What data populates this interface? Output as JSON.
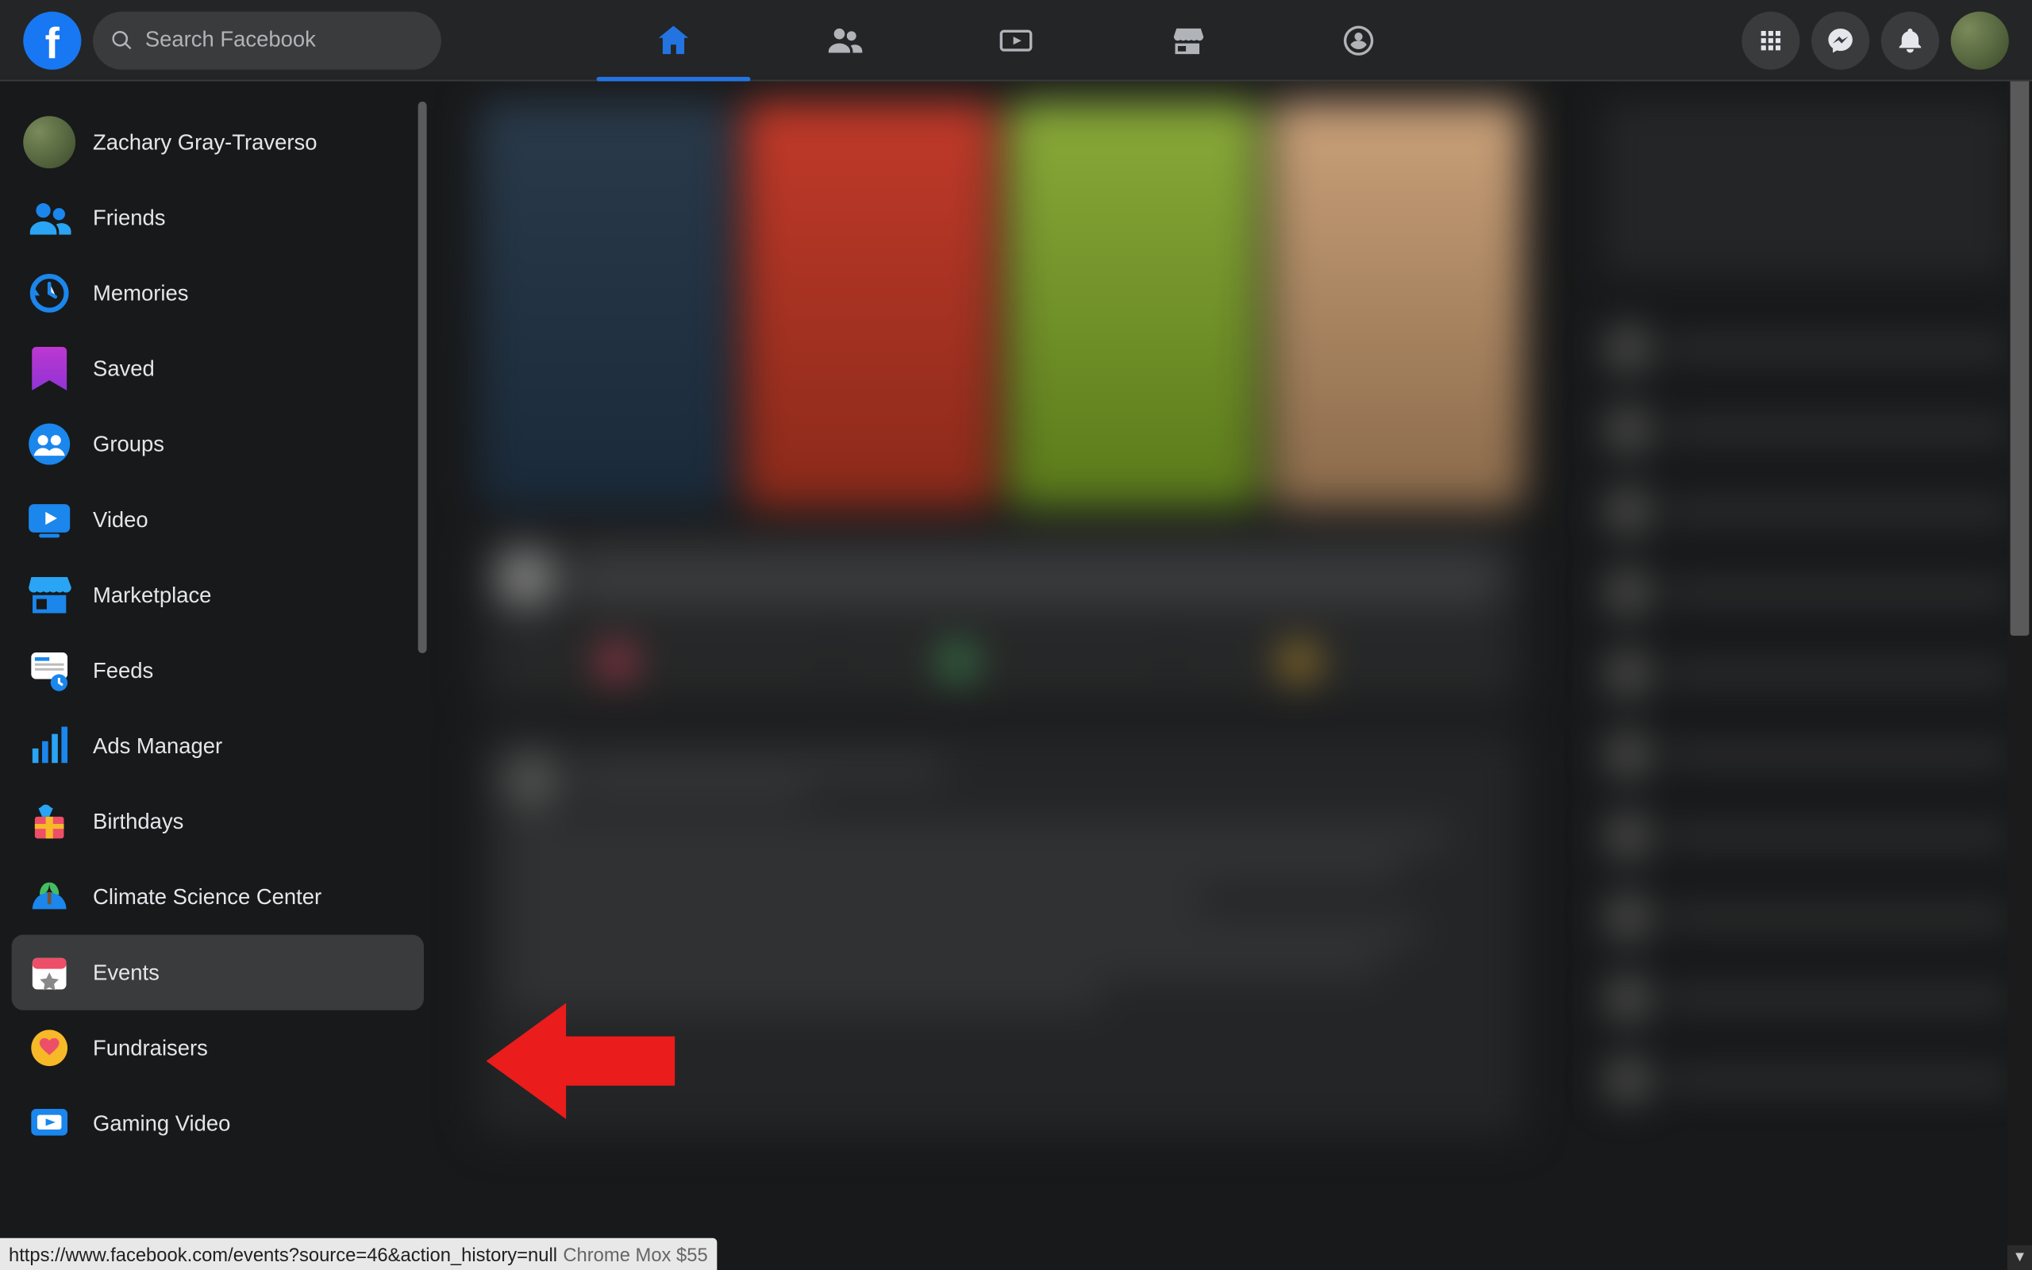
{
  "search": {
    "placeholder": "Search Facebook"
  },
  "user": {
    "name": "Zachary Gray-Traverso"
  },
  "header_tabs": {
    "home": "Home",
    "friends": "Friends",
    "video": "Video",
    "marketplace": "Marketplace",
    "groups": "Groups"
  },
  "header_right": {
    "menu": "Menu",
    "messenger": "Messenger",
    "notifications": "Notifications",
    "account": "Account"
  },
  "sidebar": {
    "items": [
      {
        "label": "Zachary Gray-Traverso",
        "icon": "avatar"
      },
      {
        "label": "Friends",
        "icon": "friends"
      },
      {
        "label": "Memories",
        "icon": "memories"
      },
      {
        "label": "Saved",
        "icon": "saved"
      },
      {
        "label": "Groups",
        "icon": "groups"
      },
      {
        "label": "Video",
        "icon": "video"
      },
      {
        "label": "Marketplace",
        "icon": "marketplace"
      },
      {
        "label": "Feeds",
        "icon": "feeds"
      },
      {
        "label": "Ads Manager",
        "icon": "ads"
      },
      {
        "label": "Birthdays",
        "icon": "birthdays"
      },
      {
        "label": "Climate Science Center",
        "icon": "climate"
      },
      {
        "label": "Events",
        "icon": "events",
        "highlight": true
      },
      {
        "label": "Fundraisers",
        "icon": "fundraisers"
      },
      {
        "label": "Gaming Video",
        "icon": "gaming"
      }
    ]
  },
  "status_text": "https://www.facebook.com/events?source=46&action_history=null",
  "status_tail": "Chrome Mox $55",
  "colors": {
    "fb_blue": "#1877f2",
    "bg": "#18191a",
    "card": "#242526",
    "hover": "#3a3b3c",
    "text": "#e4e6eb",
    "muted": "#b0b3b8",
    "annotation_red": "#ea1c1c"
  }
}
